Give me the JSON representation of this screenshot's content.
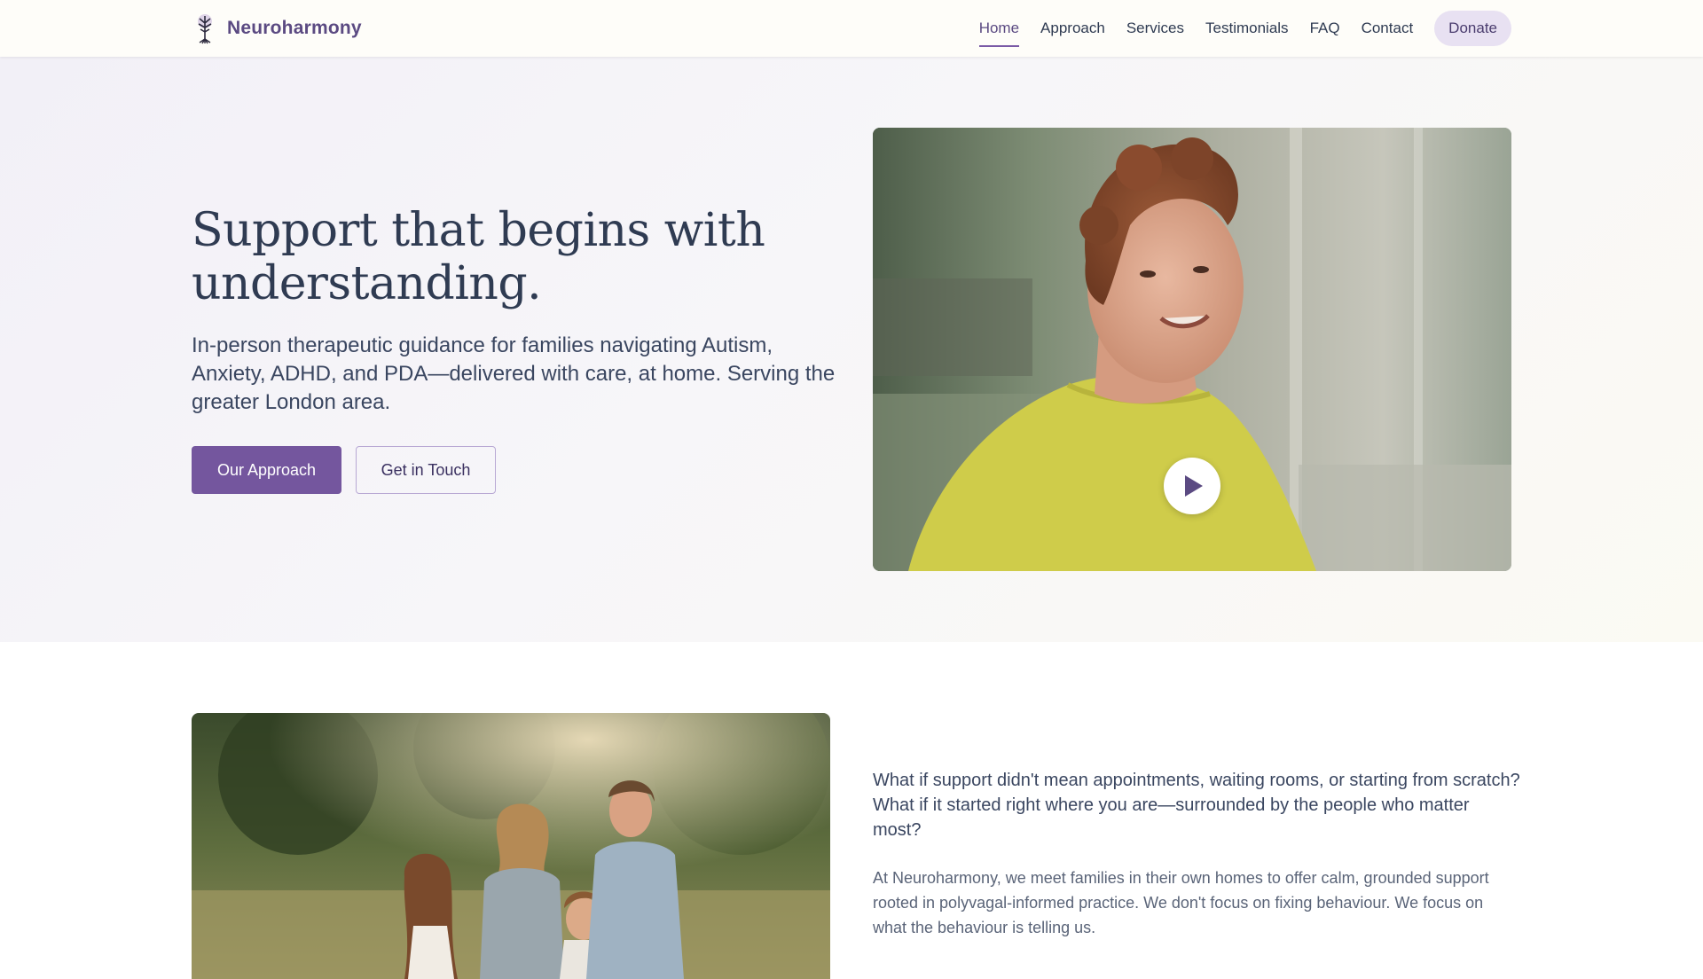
{
  "brand": {
    "name": "Neuroharmony",
    "logo_icon": "tree-of-life-icon"
  },
  "nav": {
    "items": [
      {
        "label": "Home",
        "active": true
      },
      {
        "label": "Approach",
        "active": false
      },
      {
        "label": "Services",
        "active": false
      },
      {
        "label": "Testimonials",
        "active": false
      },
      {
        "label": "FAQ",
        "active": false
      },
      {
        "label": "Contact",
        "active": false
      }
    ],
    "donate_label": "Donate"
  },
  "hero": {
    "title": "Support that begins with understanding.",
    "subtitle": "In-person therapeutic guidance for families navigating Autism, Anxiety, ADHD, and PDA—delivered with care, at home. Serving the greater London area.",
    "primary_cta": "Our Approach",
    "secondary_cta": "Get in Touch",
    "video": {
      "play_icon": "play-icon"
    }
  },
  "intro": {
    "lead": "What if support didn't mean appointments, waiting rooms, or starting from scratch? What if it started right where you are—surrounded by the people who matter most?",
    "body": "At Neuroharmony, we meet families in their own homes to offer calm, grounded support rooted in polyvagal-informed practice. We don't focus on fixing behaviour. We focus on what the behaviour is telling us."
  },
  "colors": {
    "brand_purple": "#74569e",
    "text_dark": "#2f3b52",
    "donate_bg": "#e8e1f2"
  }
}
